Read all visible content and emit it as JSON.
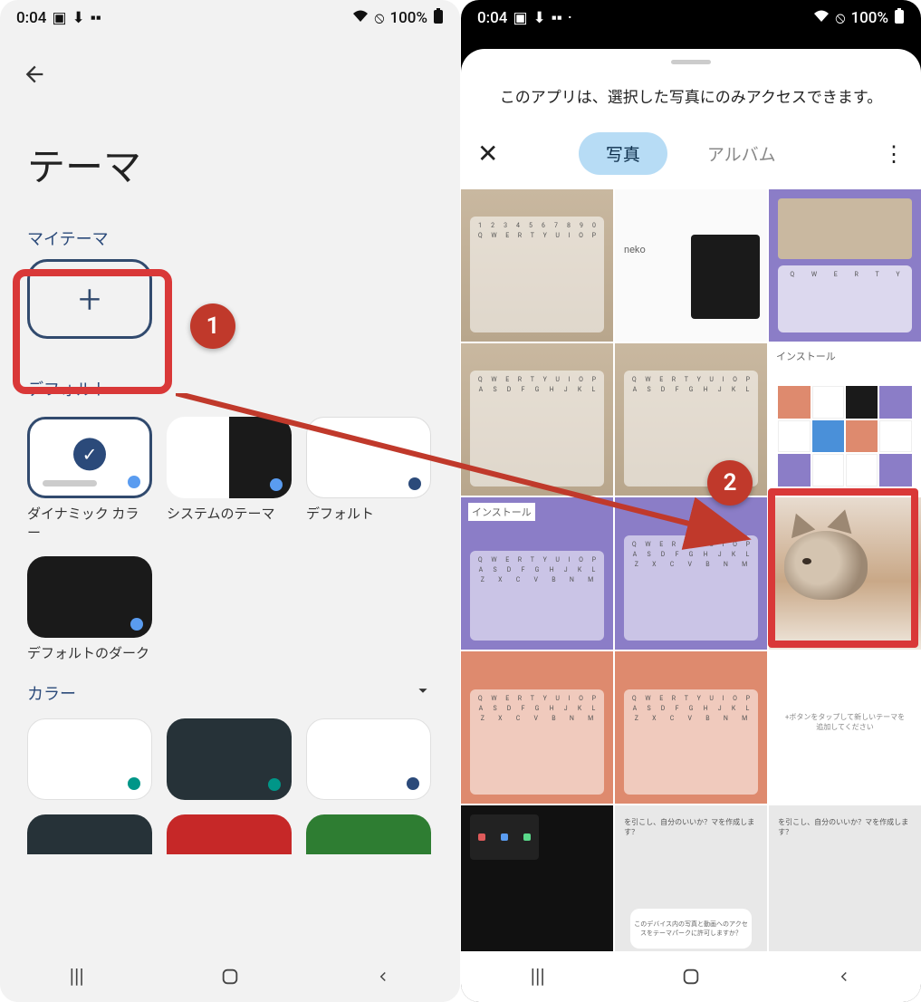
{
  "status": {
    "time": "0:04",
    "battery": "100%",
    "wifi_icon": "wifi",
    "block_icon": "⦸"
  },
  "left": {
    "page_title": "テーマ",
    "sections": {
      "my_themes": "マイテーマ",
      "default": "デフォルト",
      "color": "カラー"
    },
    "themes": {
      "dynamic": "ダイナミック カラー",
      "system": "システムのテーマ",
      "default": "デフォルト",
      "default_dark": "デフォルトのダーク"
    }
  },
  "right": {
    "permission_text": "このアプリは、選択した写真にのみアクセスできます。",
    "tabs": {
      "photos": "写真",
      "albums": "アルバム"
    },
    "labels": {
      "install": "インストール",
      "neko": "neko"
    }
  },
  "annotations": {
    "step1": "1",
    "step2": "2"
  }
}
